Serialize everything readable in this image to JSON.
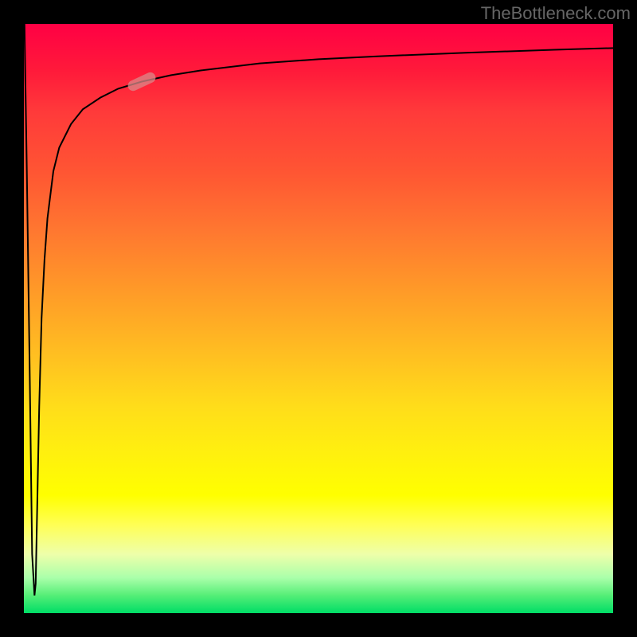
{
  "watermark": "TheBottleneck.com",
  "colors": {
    "background": "#000000",
    "gradient_top": "#ff0044",
    "gradient_mid": "#ffee10",
    "gradient_bottom": "#00dd66",
    "curve": "#000000",
    "marker": "#d98a8a"
  },
  "chart_data": {
    "type": "line",
    "title": "",
    "xlabel": "",
    "ylabel": "",
    "xlim": [
      0,
      100
    ],
    "ylim": [
      0,
      100
    ],
    "grid": false,
    "legend": false,
    "series": [
      {
        "name": "curve",
        "x": [
          0.1,
          0.5,
          1,
          1.4,
          1.8,
          2.0,
          2.2,
          2.6,
          3.0,
          3.5,
          4.0,
          5.0,
          6.0,
          8.0,
          10.0,
          13.0,
          16.0,
          20.0,
          25.0,
          30.0,
          40.0,
          50.0,
          60.0,
          75.0,
          90.0,
          100.0
        ],
        "y": [
          100,
          75,
          40,
          10,
          3,
          5,
          15,
          35,
          50,
          60,
          67,
          75,
          79,
          83,
          85.5,
          87.5,
          89,
          90.2,
          91.3,
          92.1,
          93.3,
          94.0,
          94.5,
          95.1,
          95.6,
          95.9
        ]
      }
    ],
    "marker": {
      "x": 20,
      "y": 90.2,
      "angle": 25,
      "width": 5,
      "height": 1.8
    },
    "annotations": []
  }
}
